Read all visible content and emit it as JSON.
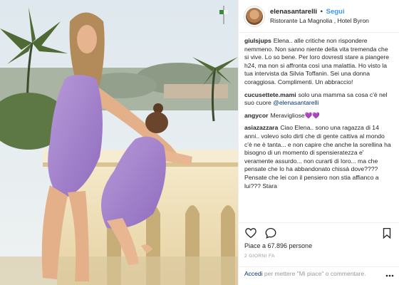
{
  "header": {
    "username": "elenasantarelli",
    "separator": "•",
    "follow_label": "Segui",
    "location": "Ristorante La Magnolia , Hotel Byron"
  },
  "comments": [
    {
      "user": "giulsjups",
      "text": "Elena.. alle critiche non rispondere nemmeno. Non sanno niente della vita tremenda che si vive. Lo so bene. Per loro dovresti stare a piangere h24, ma non si affronta così una malattia. Ho visto la tua intervista da Silvia Toffanin. Sei una donna coraggiosa. Complimenti. Un abbraccio!"
    },
    {
      "user": "cucusettete.mami",
      "text": "solo una mamma sa cosa c'è nel suo cuore",
      "mention": "@elenasantarelli"
    },
    {
      "user": "angycor",
      "text": "Meravigliose",
      "emoji": "💜💜"
    },
    {
      "user": "asiazazzara",
      "text": "Ciao Elena.. sono una ragazza di 14 anni.. volevo solo dirti che di gente cattiva al mondo c'è ne è tanta... e non capire che anche la sorellina ha bisogno di un momento di spensieratezza e' veramente assurdo... non curarti di loro... ma che pensate che lo ha abbandonato chissà dove???? Pensate che lei con il pensiero non stia affianco a lui??? Stara"
    }
  ],
  "actions": {
    "like_icon": "heart-outline-icon",
    "comment_icon": "speech-bubble-icon",
    "save_icon": "bookmark-icon"
  },
  "likes": "Piace a 67.896 persone",
  "date": "2 GIORNI FA",
  "add_comment": {
    "login_label": "Accedi",
    "rest": " per mettere \"Mi piace\" o commentare."
  }
}
